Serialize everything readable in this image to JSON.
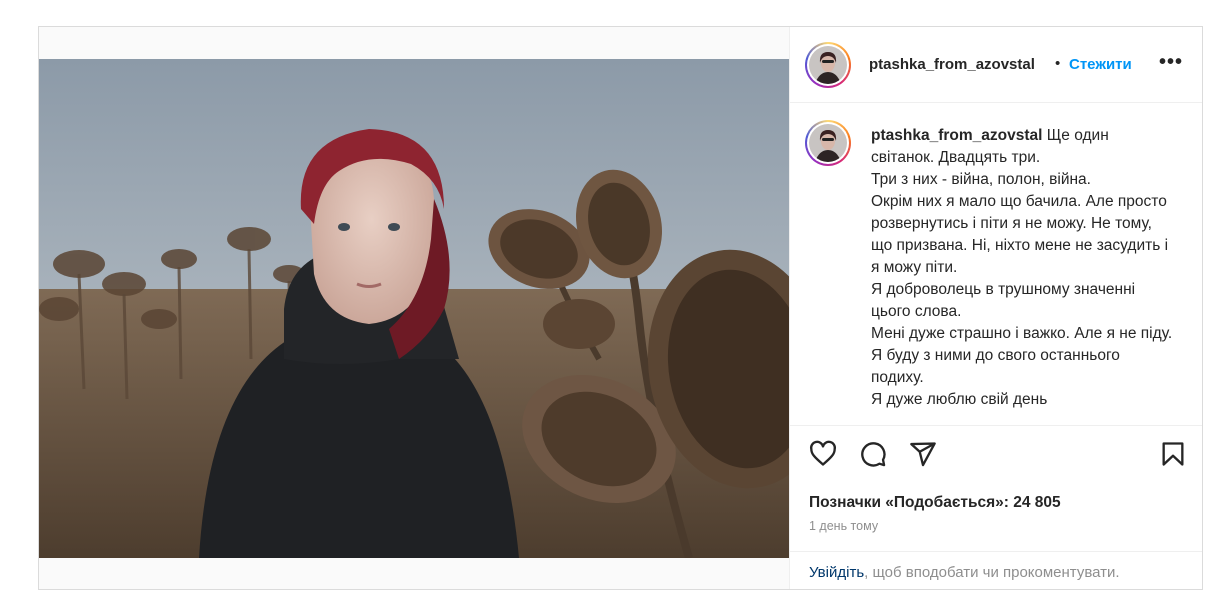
{
  "post": {
    "username": "ptashka_from_azovstal",
    "separator": "•",
    "follow_label": "Стежити",
    "more_label": "•••",
    "caption": "Ще один світанок. Двадцять три.\nТри з них - війна, полон, війна.\nОкрім них я мало що бачила. Але просто розвернутись і піти я не можу. Не тому, що призвана. Ні, ніхто мене не засудить і я можу піти.\nЯ доброволець в трушному значенні цього слова.\nМені дуже страшно і важко. Але я не піду. Я буду з ними до свого останнього подиху.\nЯ дуже люблю свій день",
    "likes_label": "Позначки «Подобається»: 24 805",
    "time_label": "1 день тому",
    "footer_link": "Увійдіть",
    "footer_text": ", щоб вподобати чи прокоментувати."
  },
  "icons": {
    "like": "heart-icon",
    "comment": "comment-icon",
    "share": "share-icon",
    "save": "bookmark-icon",
    "more": "more-icon"
  },
  "colors": {
    "accent": "#0095f6",
    "link": "#00376b",
    "muted": "#8e8e8e",
    "text": "#262626"
  }
}
